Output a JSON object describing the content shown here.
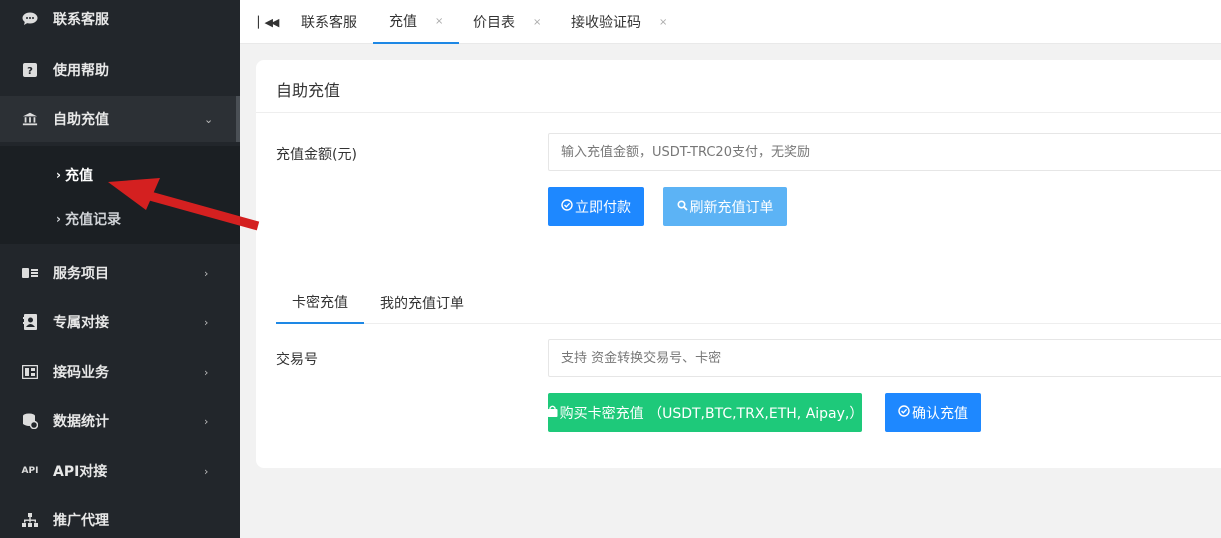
{
  "sidebar": {
    "items": [
      {
        "label": "联系客服",
        "icon": "chat-icon"
      },
      {
        "label": "使用帮助",
        "icon": "help-icon"
      },
      {
        "label": "自助充值",
        "icon": "bank-icon"
      },
      {
        "label": "服务项目",
        "icon": "id-card-icon"
      },
      {
        "label": "专属对接",
        "icon": "contact-book-icon"
      },
      {
        "label": "接码业务",
        "icon": "sms-icon"
      },
      {
        "label": "数据统计",
        "icon": "database-icon"
      },
      {
        "label": "API对接",
        "icon": "api-icon"
      },
      {
        "label": "推广代理",
        "icon": "sitemap-icon"
      }
    ],
    "submenu": [
      {
        "label": "充值"
      },
      {
        "label": "充值记录"
      }
    ]
  },
  "tabs": [
    {
      "label": "联系客服"
    },
    {
      "label": "充值",
      "close": "×"
    },
    {
      "label": "价目表",
      "close": "×"
    },
    {
      "label": "接收验证码",
      "close": "×"
    }
  ],
  "card": {
    "title": "自助充值",
    "amount_label": "充值金额(元)",
    "amount_placeholder": "输入充值金额，USDT-TRC20支付，无奖励",
    "pay_button": "立即付款",
    "refresh_button": "刷新充值订单",
    "subtabs": [
      {
        "label": "卡密充值"
      },
      {
        "label": "我的充值订单"
      }
    ],
    "txn_label": "交易号",
    "txn_placeholder": "支持 资金转换交易号、卡密",
    "buy_button": "购买卡密充值 （USDT,BTC,TRX,ETH, Aipay,）",
    "confirm_button": "确认充值"
  },
  "colors": {
    "sidebar_bg": "#22262b",
    "primary": "#1e88ff",
    "light_blue": "#5cb3f5",
    "green": "#1ec97a",
    "annotation_arrow": "#e01b1b"
  }
}
